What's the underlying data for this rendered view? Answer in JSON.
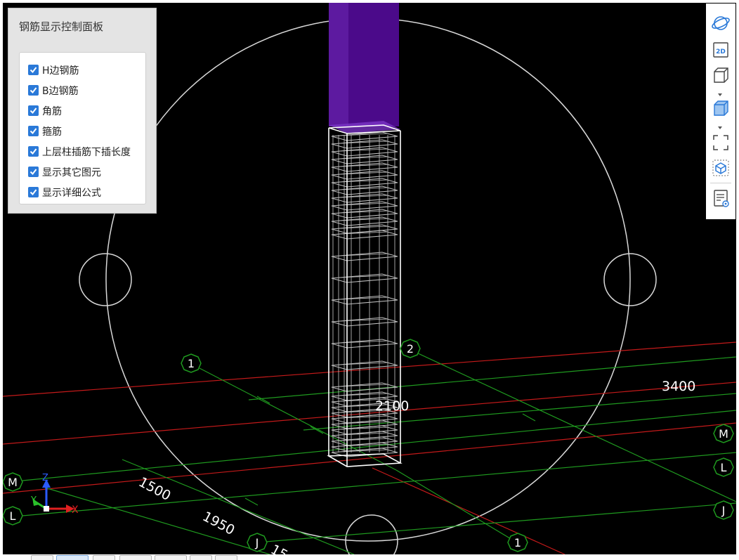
{
  "control_panel": {
    "title": "钢筋显示控制面板",
    "options": [
      {
        "label": "H边钢筋",
        "checked": true
      },
      {
        "label": "B边钢筋",
        "checked": true
      },
      {
        "label": "角筋",
        "checked": true
      },
      {
        "label": "箍筋",
        "checked": true
      },
      {
        "label": "上层柱插筋下插长度",
        "checked": true
      },
      {
        "label": "显示其它图元",
        "checked": true
      },
      {
        "label": "显示详细公式",
        "checked": true
      }
    ]
  },
  "toolbar": {
    "buttons": [
      "orbit-icon",
      "2d-view-icon",
      "3d-box-icon",
      "filled-box-icon",
      "fit-view-icon",
      "view-cube-icon",
      "properties-icon"
    ],
    "view_2d_label": "2D"
  },
  "scene": {
    "axis_bubbles": {
      "one": "1",
      "two": "2",
      "m": "M",
      "l": "L",
      "j": "J"
    },
    "dimensions": {
      "d3400": "3400",
      "d2100": "2100",
      "d1500": "1500",
      "d1950": "1950",
      "d15": "15"
    },
    "axis_triad": {
      "z": "Z",
      "y": "Y",
      "x": "X"
    },
    "colors": {
      "background": "#000000",
      "grid_green": "#1f9a1f",
      "grid_red": "#c41a1a",
      "column_purple": "#4b0a8a",
      "rebar": "#bfbfbf",
      "outline": "#ffffff"
    }
  }
}
